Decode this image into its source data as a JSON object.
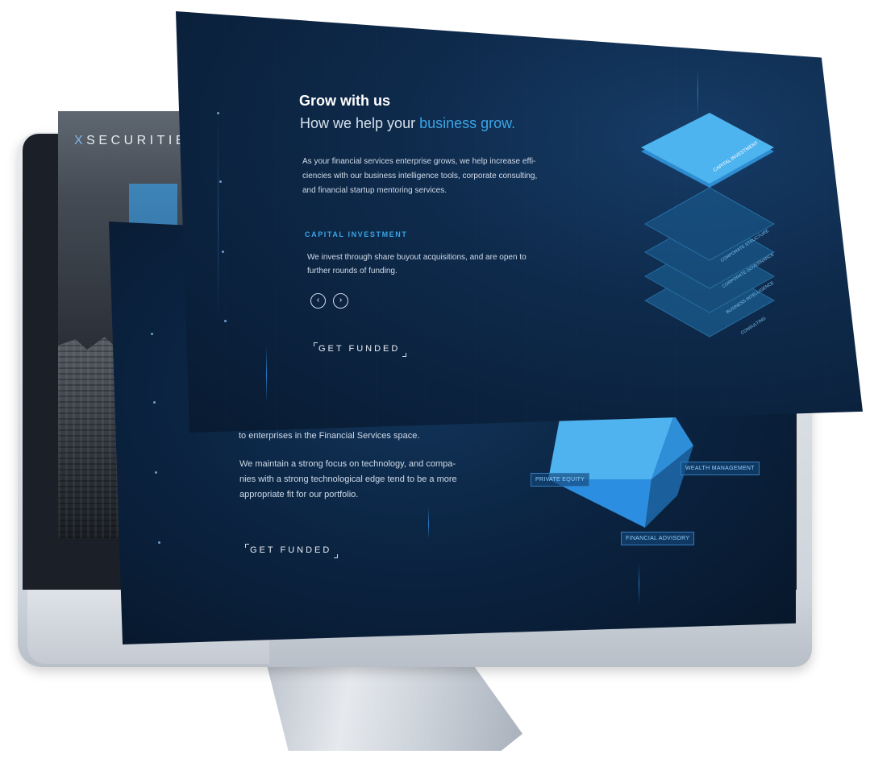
{
  "brand": {
    "logo_x": "X",
    "logo_rest": "SECURITIES"
  },
  "front": {
    "heading": "Grow with us",
    "subheading_prefix": "How we help your ",
    "subheading_accent": "business grow.",
    "intro_lines": [
      "As your financial services enterprise grows, we help increase effi-",
      "ciencies with our business intelligence tools, corporate consulting,",
      "and financial startup mentoring services."
    ],
    "section_title": "CAPITAL INVESTMENT",
    "section_lines": [
      "We invest through share buyout acquisitions, and are open to",
      "further rounds of funding."
    ],
    "prev_icon": "chevron-left-icon",
    "next_icon": "chevron-right-icon",
    "cta": "GET FUNDED",
    "layers": [
      "CAPITAL INVESTMENT",
      "CORPORATE STRUCTURE",
      "CORPORATE GOVERNANCE",
      "BUSINESS INTELLIGENCE",
      "CONSULTING"
    ]
  },
  "middle": {
    "line_partial": "to enterprises in the Financial Services space.",
    "para_lines": [
      "We maintain a strong focus on technology, and compa-",
      "nies with a strong technological edge tend to be a more",
      "appropriate fit for our portfolio."
    ],
    "cta": "GET FUNDED",
    "prism_labels": {
      "left": "PRIVATE EQUITY",
      "right": "WEALTH MANAGEMENT",
      "bottom": "FINANCIAL ADVISORY"
    }
  },
  "colors": {
    "accent": "#3ba4e6",
    "navy": "#0b2442"
  }
}
